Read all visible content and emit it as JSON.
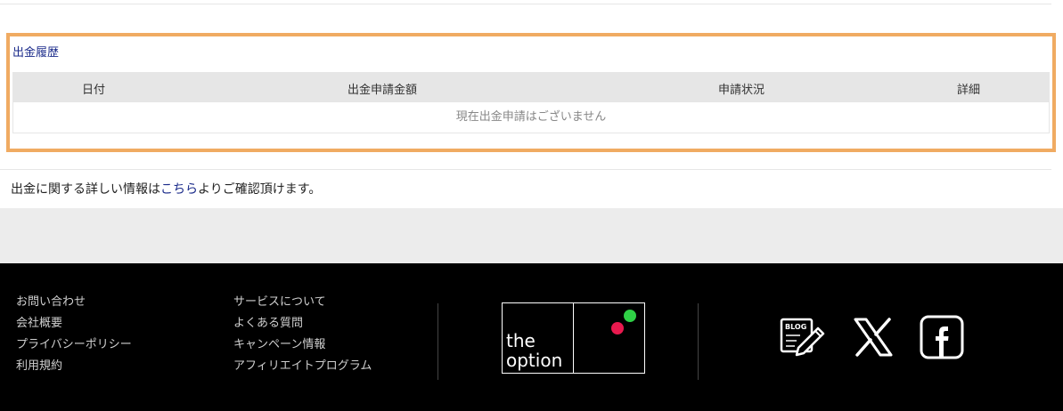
{
  "history": {
    "title": "出金履歴",
    "columns": [
      "日付",
      "出金申請金額",
      "申請状況",
      "詳細"
    ],
    "empty_message": "現在出金申請はございません"
  },
  "info": {
    "prefix": "出金に関する詳しい情報は",
    "link": "こちら",
    "suffix": "よりご確認頂けます。"
  },
  "footer": {
    "col1": [
      "お問い合わせ",
      "会社概要",
      "プライバシーポリシー",
      "利用規約"
    ],
    "col2": [
      "サービスについて",
      "よくある質問",
      "キャンペーン情報",
      "アフィリエイトプログラム"
    ],
    "logo": {
      "line1": "the",
      "line2": "option"
    },
    "social": {
      "blog": "BLOG"
    }
  },
  "colors": {
    "accent_border": "#f0ab62",
    "link": "#1a2a8a",
    "logo_green": "#2fd046",
    "logo_red": "#e8194e"
  }
}
